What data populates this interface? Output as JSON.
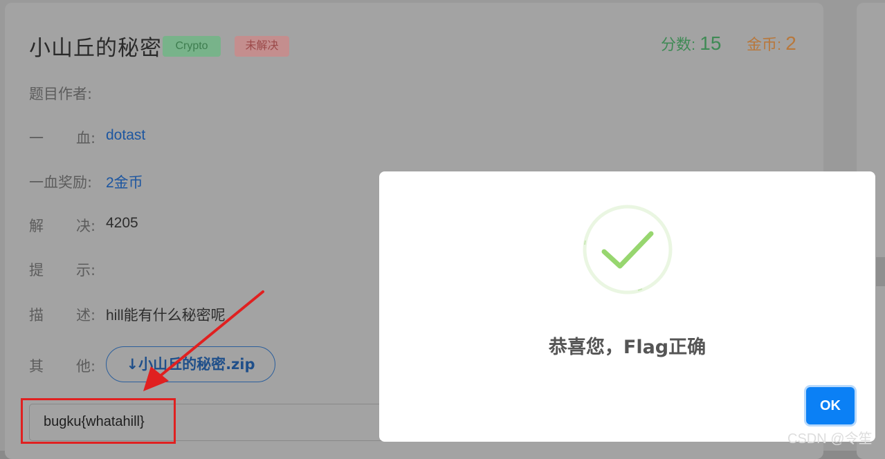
{
  "challenge": {
    "title": "小山丘的秘密",
    "category_tag": "Crypto",
    "status_tag": "未解决",
    "score_label": "分数:",
    "score_value": "15",
    "coin_label": "金币:",
    "coin_value": "2"
  },
  "details": {
    "author": {
      "label_a": "题目作者:",
      "value": ""
    },
    "first_blood": {
      "label_a": "一",
      "label_b": "血:",
      "value": "dotast"
    },
    "first_blood_reward": {
      "label_a": "一血奖励:",
      "value": "2金币"
    },
    "solves": {
      "label_a": "解",
      "label_b": "决:",
      "value": "4205"
    },
    "hint": {
      "label_a": "提",
      "label_b": "示:",
      "value": ""
    },
    "description": {
      "label_a": "描",
      "label_b": "述:",
      "value": "hill能有什么秘密呢"
    },
    "other": {
      "label_a": "其",
      "label_b": "他:",
      "download_label": "↓小山丘的秘密.zip"
    }
  },
  "flag_input": {
    "value": "bugku{whatahill}"
  },
  "modal": {
    "message": "恭喜您，Flag正确",
    "ok_label": "OK",
    "icon": "success-check-icon",
    "accent": "#0b80f5",
    "check_color": "#97d66f"
  },
  "annotation": {
    "color": "#e02020"
  },
  "watermark": "CSDN @令笙"
}
